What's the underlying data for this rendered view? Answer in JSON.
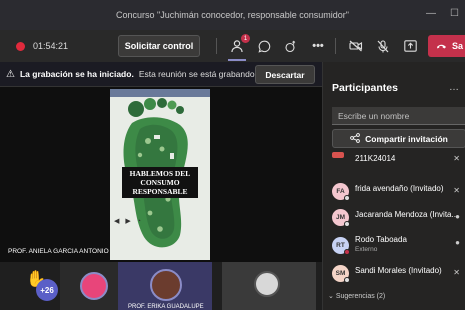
{
  "window": {
    "title": "Concurso \"Juchimán conocedor, responsable consumidor\""
  },
  "toolbar": {
    "timer": "01:54:21",
    "request_control_label": "Solicitar control",
    "participants_badge": "1",
    "leave_label": "Sa"
  },
  "banner": {
    "title": "La grabación se ha iniciado.",
    "message": "Esta reunión se está grabando. Al...",
    "dismiss_label": "Descartar"
  },
  "stage": {
    "shared_title": "HABLEMOS DEL CONSUMO RESPONSABLE",
    "presenter": "PROF. ANIELA GARCIA ANTONIO",
    "bottom_presenter": "PROF. ERIKA GUADALUPE"
  },
  "bottom_bar": {
    "overflow_count": "+26"
  },
  "panel": {
    "title": "Participantes",
    "search_placeholder": "Escribe un nombre",
    "share_invite_label": "Compartir invitación",
    "participants": [
      {
        "initials": "",
        "name": "211K24014",
        "subtitle": "",
        "color": "#d9534f"
      },
      {
        "initials": "FA",
        "name": "frida avendaño (Invitado)",
        "subtitle": "",
        "color": "#f4c7cf"
      },
      {
        "initials": "JM",
        "name": "Jacaranda Mendoza (Invita...",
        "subtitle": "",
        "color": "#f4c7cf"
      },
      {
        "initials": "RT",
        "name": "Rodo Taboada",
        "subtitle": "Externo",
        "color": "#c7d2f4"
      },
      {
        "initials": "SM",
        "name": "Sandi Morales (Invitado)",
        "subtitle": "",
        "color": "#f4d4c7"
      }
    ],
    "suggestions_label": "Sugerencias (2)"
  },
  "colors": {
    "accent": "#8b8cc7",
    "leave": "#c4314b",
    "record": "#e02a3c"
  }
}
